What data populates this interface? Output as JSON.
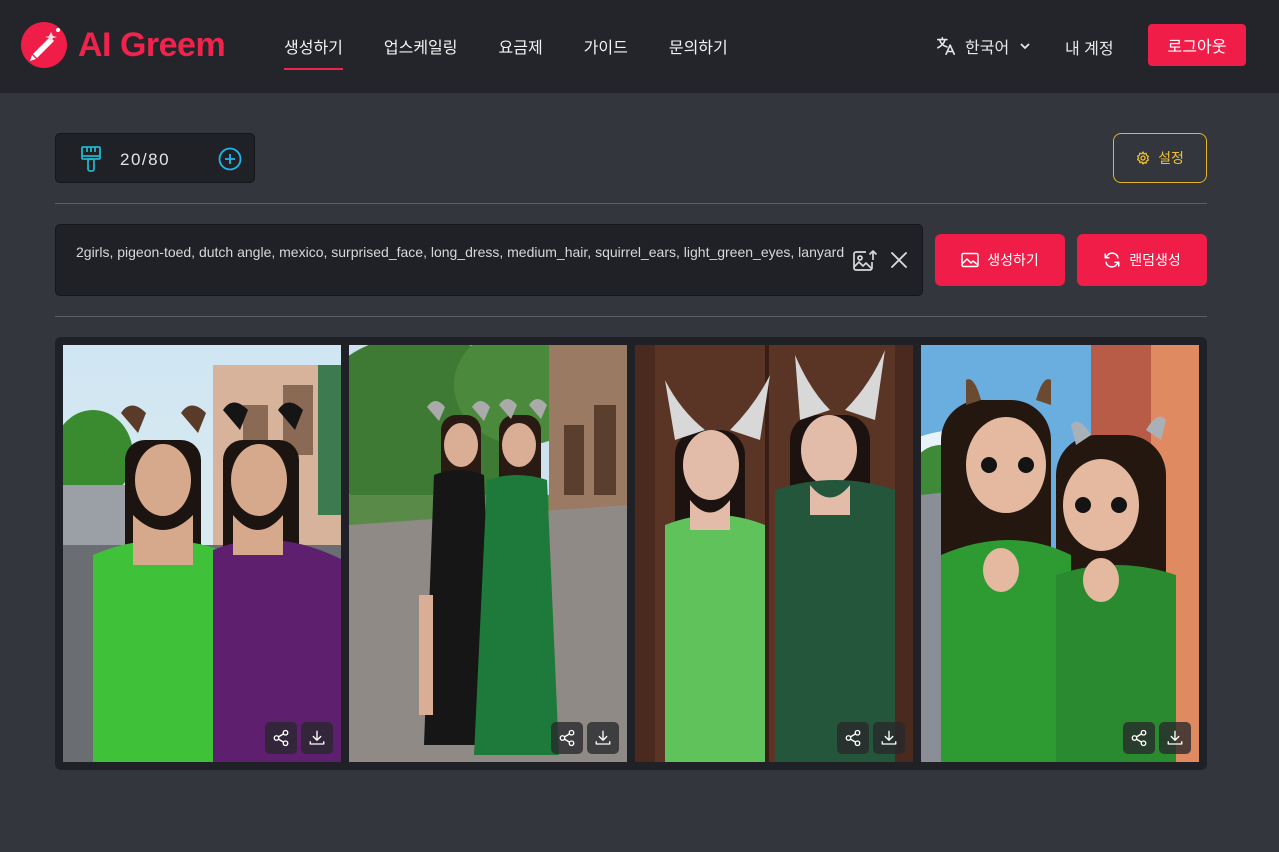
{
  "brand": {
    "name": "AI Greem",
    "accent": "#f01d48"
  },
  "nav": {
    "items": [
      {
        "label": "생성하기",
        "active": true
      },
      {
        "label": "업스케일링"
      },
      {
        "label": "요금제"
      },
      {
        "label": "가이드"
      },
      {
        "label": "문의하기"
      }
    ]
  },
  "header": {
    "language": "한국어",
    "account": "내 계정",
    "logout": "로그아웃"
  },
  "credits": {
    "value": "20/80",
    "icon": "brush-icon"
  },
  "settings": {
    "label": "설정",
    "color": "#f0c233"
  },
  "prompt": {
    "text": "2girls, pigeon-toed, dutch angle, mexico, surprised_face, long_dress, medium_hair, squirrel_ears, light_green_eyes, lanyard"
  },
  "actions": {
    "generate": "생성하기",
    "random": "랜덤생성"
  },
  "gallery": {
    "images": [
      {
        "name": "generated-image-1",
        "dresses": [
          "#3fc23a",
          "#5d1f6e"
        ]
      },
      {
        "name": "generated-image-2",
        "dresses": [
          "#161616",
          "#1e7a3a"
        ]
      },
      {
        "name": "generated-image-3",
        "dresses": [
          "#5fc25a",
          "#24563c"
        ]
      },
      {
        "name": "generated-image-4",
        "dresses": [
          "#2e9a32",
          "#2a8a30"
        ]
      }
    ],
    "actions": [
      "share-icon",
      "download-icon"
    ]
  }
}
